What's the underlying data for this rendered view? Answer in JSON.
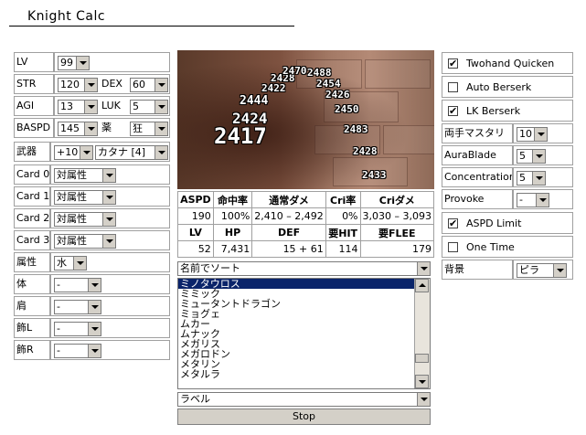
{
  "app": {
    "title": "Knight Calc"
  },
  "left": {
    "lv": {
      "label": "LV",
      "value": "99"
    },
    "stats": [
      {
        "label": "STR",
        "value": "120",
        "label2": "DEX",
        "value2": "60"
      },
      {
        "label": "AGI",
        "value": "13",
        "label2": "LUK",
        "value2": "5"
      },
      {
        "label": "BASPD",
        "value": "145",
        "label2": "薬",
        "value2": "狂"
      }
    ],
    "weapon": {
      "label": "武器",
      "refine": "+10",
      "name": "カタナ [4]"
    },
    "cards": [
      {
        "label": "Card 0",
        "value": "対属性"
      },
      {
        "label": "Card 1",
        "value": "対属性"
      },
      {
        "label": "Card 2",
        "value": "対属性"
      },
      {
        "label": "Card 3",
        "value": "対属性"
      }
    ],
    "element": {
      "label": "属性",
      "value": "水"
    },
    "armor": [
      {
        "label": "体",
        "value": "-"
      },
      {
        "label": "肩",
        "value": "-"
      },
      {
        "label": "飾L",
        "value": "-"
      },
      {
        "label": "飾R",
        "value": "-"
      }
    ]
  },
  "scene": {
    "numbers": [
      "2417",
      "2424",
      "2444",
      "2422",
      "2428",
      "2470",
      "2488",
      "2454",
      "2426",
      "2450",
      "2483",
      "2428",
      "2433"
    ]
  },
  "stats_table": {
    "row1_headers": [
      "ASPD",
      "命中率",
      "通常ダメ",
      "Cri率",
      "Criダメ"
    ],
    "row1_values": [
      "190",
      "100%",
      "2,410 – 2,492",
      "0%",
      "3,030 – 3,093"
    ],
    "row2_headers": [
      "LV",
      "HP",
      "DEF",
      "要HIT",
      "要FLEE"
    ],
    "row2_values": [
      "52",
      "7,431",
      "15 + 61",
      "114",
      "179"
    ]
  },
  "monster": {
    "sort_select": "名前でソート",
    "list": [
      "ミノタウロス",
      "ミミック",
      "ミュータントドラゴン",
      "ミョグェ",
      "ムカー",
      "ムナック",
      "メガリス",
      "メガロドン",
      "メタリン",
      "メタルラ"
    ],
    "selected_index": 0,
    "label_select": "ラベル",
    "stop_label": "Stop"
  },
  "right": {
    "checkboxes_top": [
      {
        "label": "Twohand Quicken",
        "checked": true
      },
      {
        "label": "Auto Berserk",
        "checked": false
      },
      {
        "label": "LK Berserk",
        "checked": true
      }
    ],
    "skills": [
      {
        "label": "両手マスタリ",
        "value": "10"
      },
      {
        "label": "AuraBlade",
        "value": "5"
      },
      {
        "label": "Concentration",
        "value": "5"
      },
      {
        "label": "Provoke",
        "value": "-"
      }
    ],
    "checkboxes_bottom": [
      {
        "label": "ASPD Limit",
        "checked": true
      },
      {
        "label": "One Time",
        "checked": false
      }
    ],
    "background": {
      "label": "背景",
      "value": "ピラ"
    }
  }
}
